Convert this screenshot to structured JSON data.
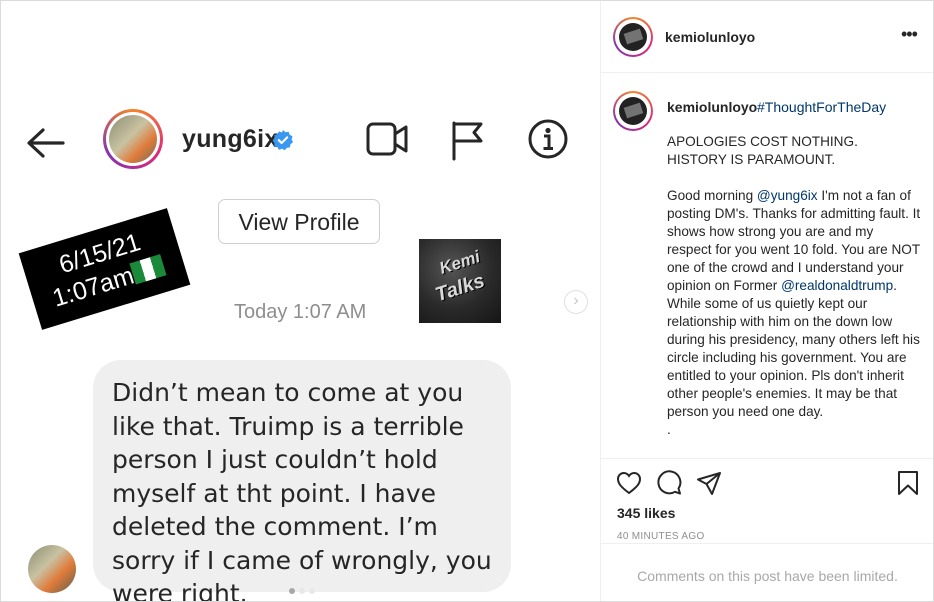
{
  "dm": {
    "username": "yung6ix",
    "view_profile_label": "View Profile",
    "timestamp": "Today 1:07 AM",
    "message": "Didn’t mean to come at you like that. Truimp is a terrible person I just couldn’t hold myself at tht point. I have deleted the comment. I’m sorry if I came of wrongly, you were right.",
    "stamp_date": "6/15/21",
    "stamp_time": "1:07am",
    "logo_line1": "Kemi",
    "logo_line2": "Talks"
  },
  "post": {
    "author": "kemiolunloyo",
    "hashtag": "#ThoughtForTheDay",
    "caption_title": "APOLOGIES COST NOTHING. HISTORY IS PARAMOUNT.",
    "caption_p1": "Good morning ",
    "mention1": "@yung6ix",
    "caption_p2": " I'm not a fan of posting DM's. Thanks for admitting fault. It shows how strong you are and my respect for you went 10 fold. You are NOT one of the crowd and I understand your opinion on Former ",
    "mention2": "@realdonaldtrump",
    "caption_p3": ". While some of us quietly kept our relationship with him on the down low during his presidency, many others left his circle including his government. You are entitled to your opinion. Pls don't inherit other people's enemies. It may be that person you need one day.",
    "caption_tail": ".",
    "likes": "345 likes",
    "time_ago": "40 MINUTES AGO",
    "comments_limited": "Comments on this post have been limited."
  },
  "colors": {
    "link": "#00376b",
    "verified": "#3897f0",
    "muted": "#8e8e8e"
  }
}
